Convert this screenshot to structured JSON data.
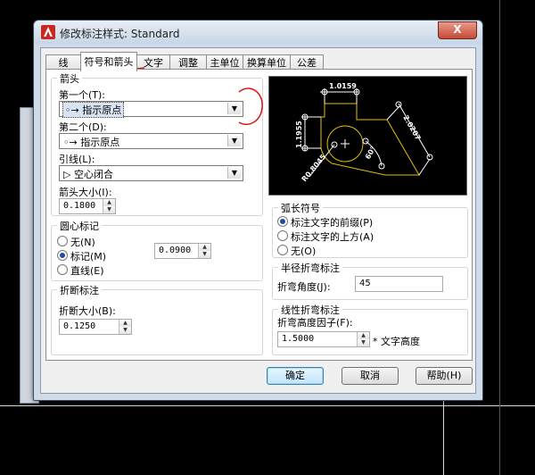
{
  "window": {
    "title": "修改标注样式: Standard",
    "close_label": "X"
  },
  "tabs": [
    {
      "label": "线",
      "active": false
    },
    {
      "label": "符号和箭头",
      "active": true
    },
    {
      "label": "文字",
      "active": false
    },
    {
      "label": "调整",
      "active": false
    },
    {
      "label": "主单位",
      "active": false
    },
    {
      "label": "换算单位",
      "active": false
    },
    {
      "label": "公差",
      "active": false
    }
  ],
  "arrowheads": {
    "title": "箭头",
    "first_label": "第一个(T):",
    "first_value": "指示原点",
    "second_label": "第二个(D):",
    "second_value": "指示原点",
    "leader_label": "引线(L):",
    "leader_value": "空心闭合",
    "size_label": "箭头大小(I):",
    "size_value": "0.1800"
  },
  "center_marks": {
    "title": "圆心标记",
    "none_label": "无(N)",
    "mark_label": "标记(M)",
    "line_label": "直线(E)",
    "selected": "mark",
    "size_value": "0.0900"
  },
  "dim_break": {
    "title": "折断标注",
    "size_label": "折断大小(B):",
    "size_value": "0.1250"
  },
  "arc_length": {
    "title": "弧长符号",
    "options": [
      "标注文字的前缀(P)",
      "标注文字的上方(A)",
      "无(O)"
    ],
    "selected": 0
  },
  "radius_jog": {
    "title": "半径折弯标注",
    "angle_label": "折弯角度(J):",
    "angle_value": "45"
  },
  "linear_jog": {
    "title": "线性折弯标注",
    "factor_label": "折弯高度因子(F):",
    "factor_value": "1.5000",
    "suffix": "* 文字高度"
  },
  "preview": {
    "dim_top": "1.0159",
    "dim_left": "1.1955",
    "dim_right": "2.0207",
    "dim_angle": "60°",
    "dim_radius": "R0.8045"
  },
  "buttons": {
    "ok": "确定",
    "cancel": "取消",
    "help": "帮助(H)"
  },
  "colors": {
    "annotation_red": "#e01010",
    "preview_yellow": "#e8c000",
    "preview_white": "#ffffff"
  }
}
